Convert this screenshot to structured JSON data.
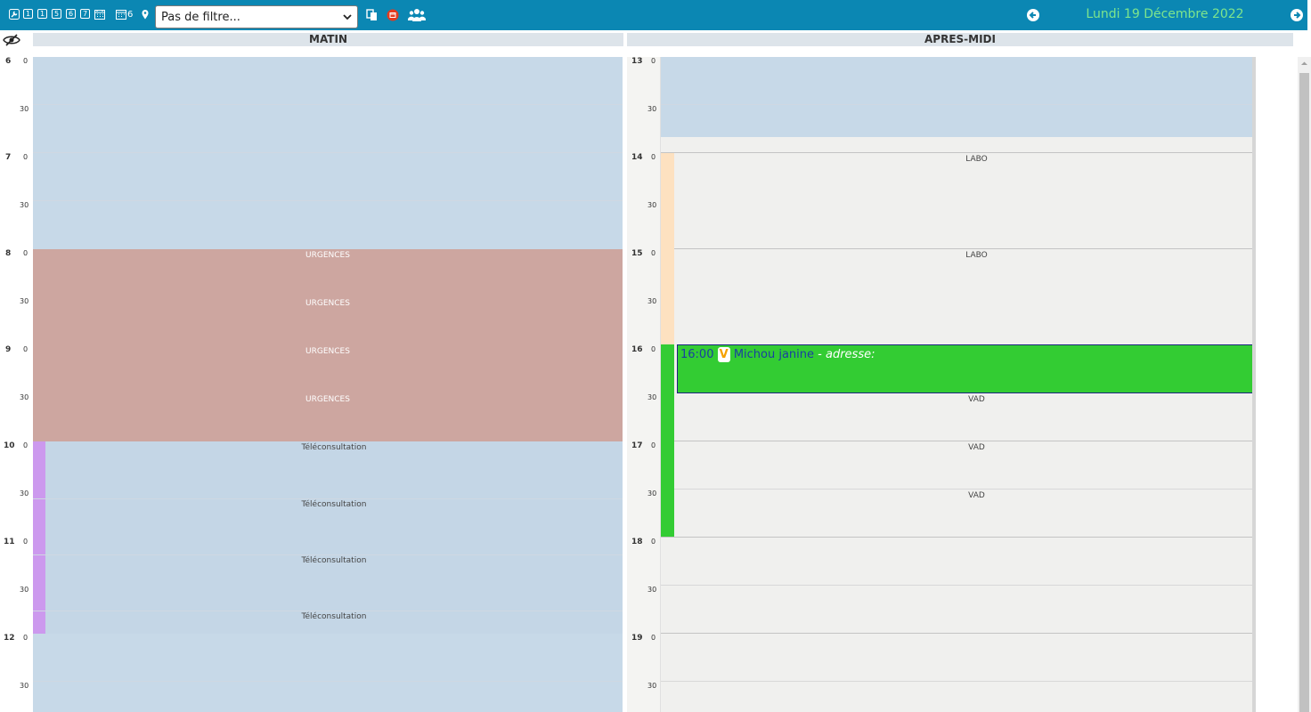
{
  "toolbar": {
    "day_buttons": [
      "1",
      "1",
      "5",
      "6",
      "7"
    ],
    "week_count": "6",
    "filter": {
      "selected": "Pas de filtre..."
    },
    "date": "Lundi 19 Décembre 2022"
  },
  "header": {
    "morning": "MATIN",
    "afternoon": "APRES-MIDI"
  },
  "gutter": {
    "morning_hours": [
      "6",
      "7",
      "8",
      "9",
      "10",
      "11",
      "12"
    ],
    "afternoon_hours": [
      "13",
      "14",
      "15",
      "16",
      "17",
      "18",
      "19"
    ],
    "min_zero": "0",
    "min_thirty": "30"
  },
  "morning_slots": {
    "urgences": "URGENCES",
    "teleconsultation": "Téléconsultation"
  },
  "afternoon_slots": {
    "labo": "LABO",
    "vad": "VAD"
  },
  "appointment": {
    "time": "16:00",
    "badge": "V",
    "patient": "Michou janine",
    "address_label": "- adresse:"
  },
  "colors": {
    "toolbar": "#0b87b3",
    "free_slot": "#c7d9e8",
    "urgences": "#cda6a0",
    "teleconsultation_marker": "#cc99ee",
    "labo_marker": "#fde1c0",
    "vad_marker": "#33cc33",
    "appointment": "#33cc33",
    "date_text": "#7ee58c"
  },
  "icons": [
    "wrench-icon",
    "calendar-week-icon",
    "map-pin-icon",
    "copy-icon",
    "calendar-red-icon",
    "users-icon",
    "eye-slash-icon",
    "arrow-left-icon",
    "arrow-right-icon"
  ]
}
